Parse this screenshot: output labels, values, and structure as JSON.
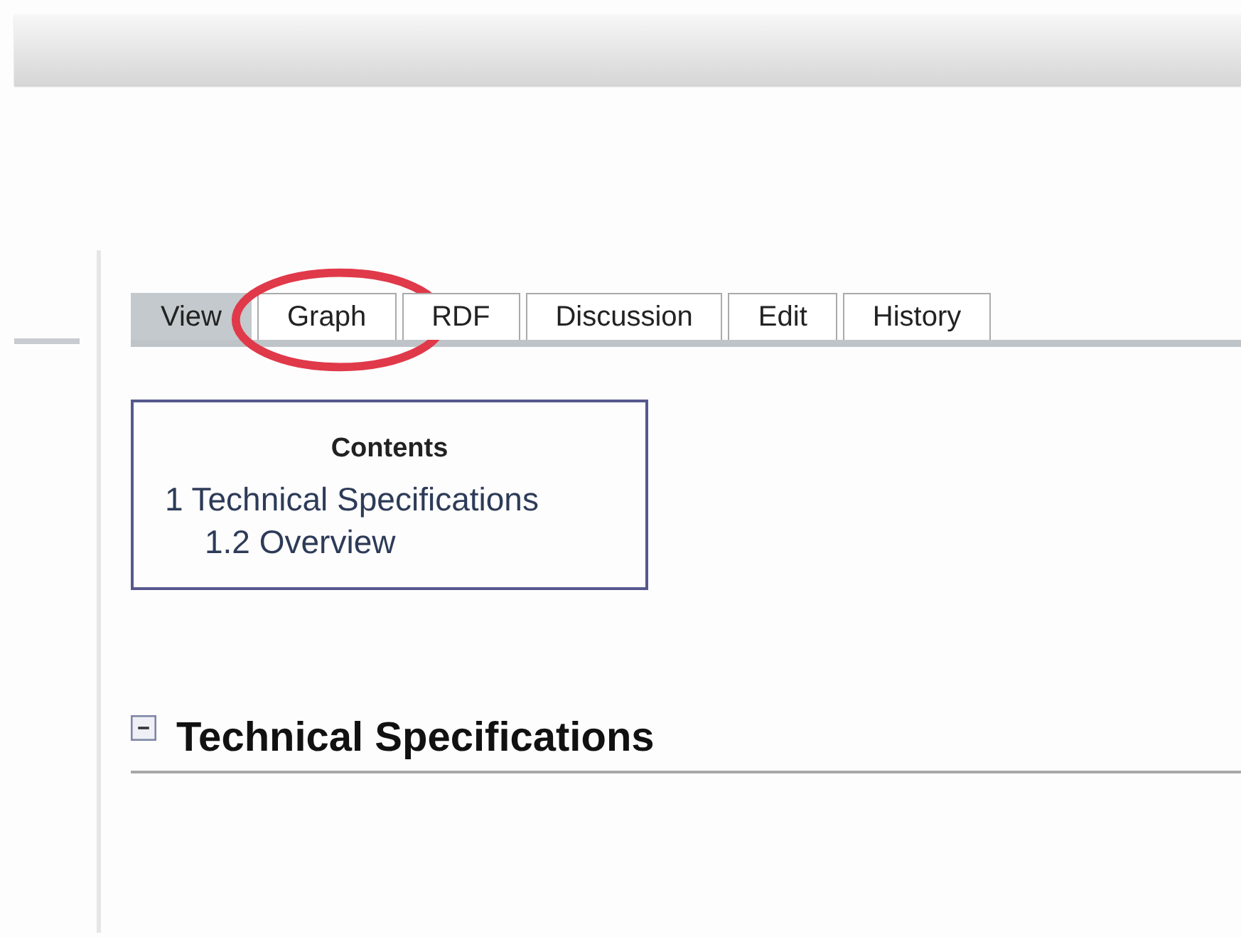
{
  "tabs": [
    {
      "label": "View",
      "selected": true
    },
    {
      "label": "Graph",
      "selected": false,
      "circled": true
    },
    {
      "label": "RDF",
      "selected": false
    },
    {
      "label": "Discussion",
      "selected": false
    },
    {
      "label": "Edit",
      "selected": false
    },
    {
      "label": "History",
      "selected": false
    }
  ],
  "toc": {
    "title": "Contents",
    "items": [
      {
        "label": "1 Technical Specifications",
        "children": [
          {
            "label": "1.2 Overview"
          }
        ]
      }
    ]
  },
  "section": {
    "title": "Technical Specifications",
    "expanded": true
  }
}
